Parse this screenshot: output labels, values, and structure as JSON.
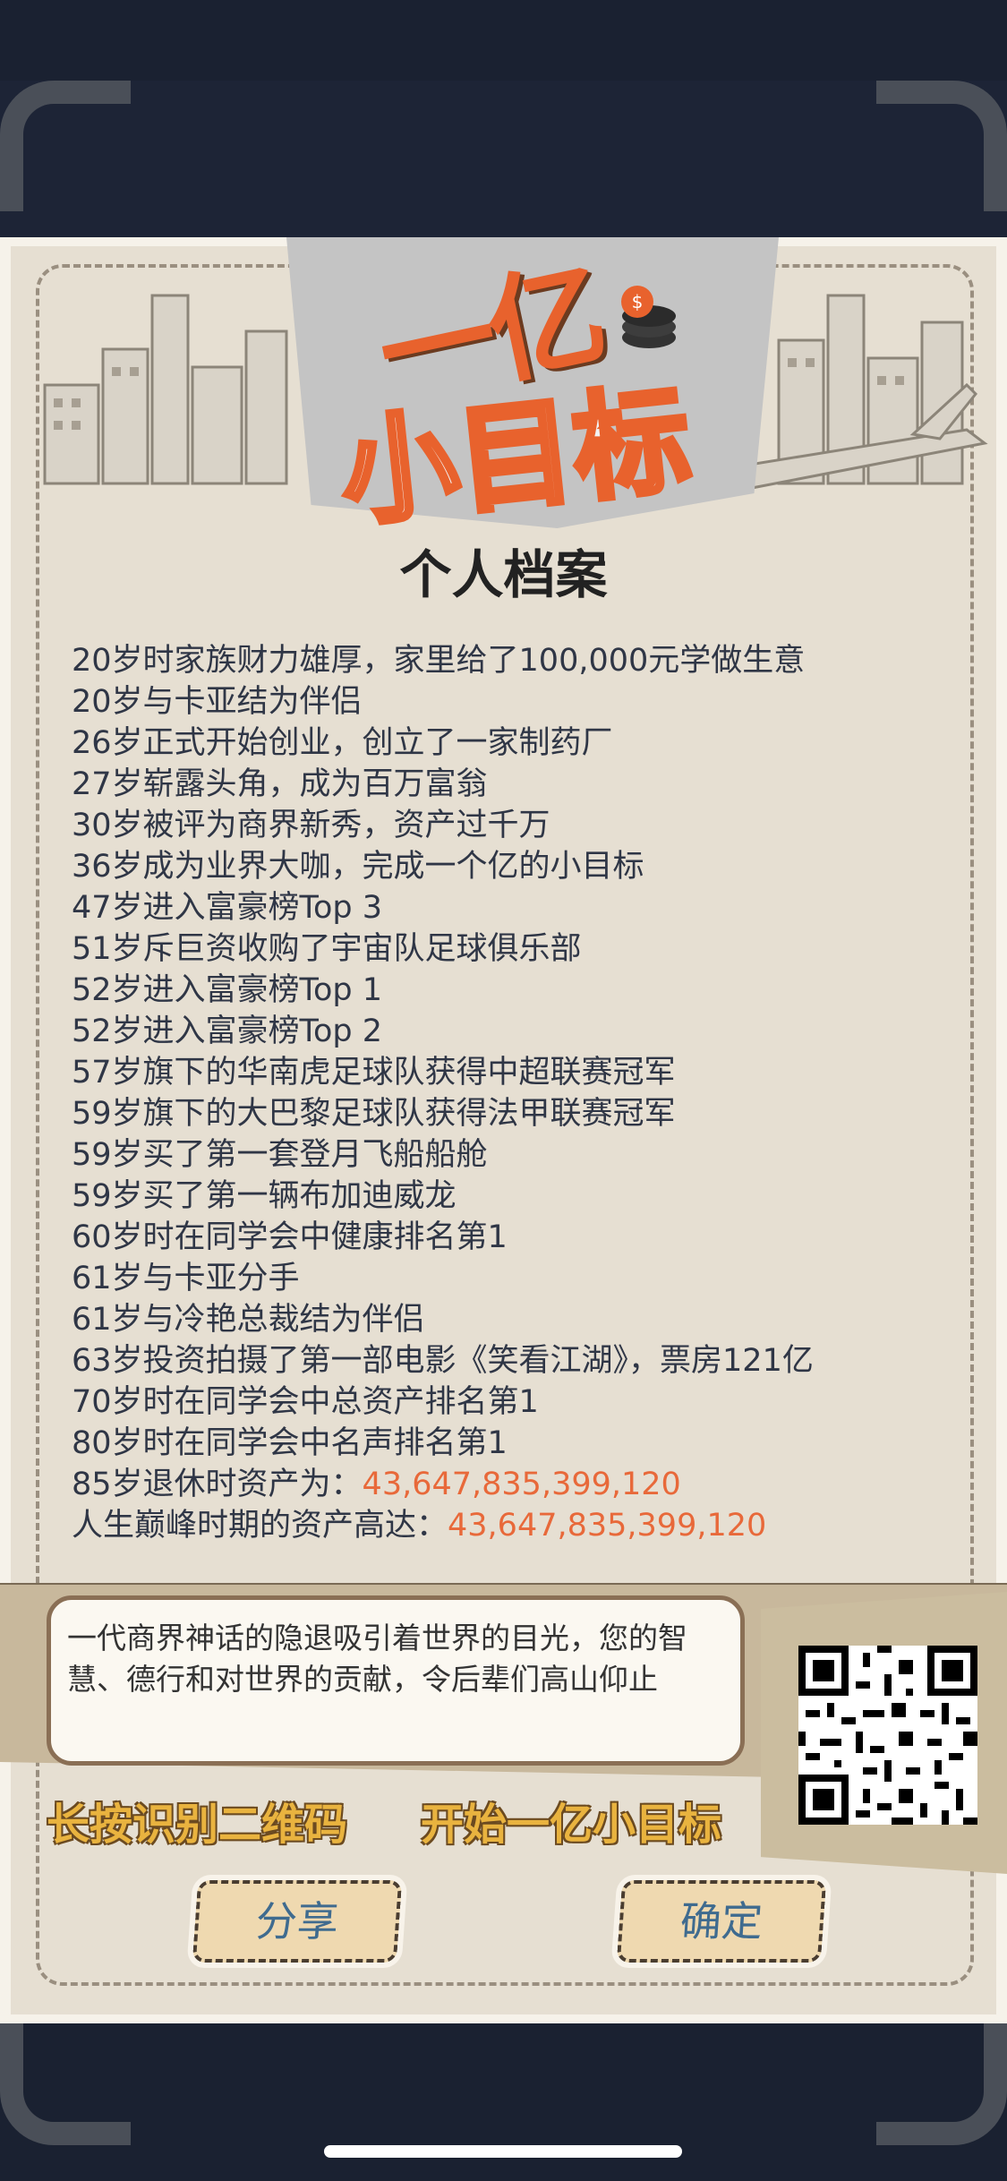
{
  "logo": {
    "line1": "一亿",
    "line2": "小目标"
  },
  "title": "个人档案",
  "events": [
    {
      "text": "20岁时家族财力雄厚，家里给了100,000元学做生意"
    },
    {
      "text": "20岁与卡亚结为伴侣"
    },
    {
      "text": "26岁正式开始创业，创立了一家制药厂"
    },
    {
      "text": "27岁崭露头角，成为百万富翁"
    },
    {
      "text": "30岁被评为商界新秀，资产过千万"
    },
    {
      "text": "36岁成为业界大咖，完成一个亿的小目标"
    },
    {
      "text": "47岁进入富豪榜Top 3"
    },
    {
      "text": "51岁斥巨资收购了宇宙队足球俱乐部"
    },
    {
      "text": "52岁进入富豪榜Top 1"
    },
    {
      "text": "52岁进入富豪榜Top 2"
    },
    {
      "text": "57岁旗下的华南虎足球队获得中超联赛冠军"
    },
    {
      "text": "59岁旗下的大巴黎足球队获得法甲联赛冠军"
    },
    {
      "text": "59岁买了第一套登月飞船船舱"
    },
    {
      "text": "59岁买了第一辆布加迪威龙"
    },
    {
      "text": "60岁时在同学会中健康排名第1"
    },
    {
      "text": "61岁与卡亚分手"
    },
    {
      "text": "61岁与冷艳总裁结为伴侣"
    },
    {
      "text": "63岁投资拍摄了第一部电影《笑看江湖》，票房121亿"
    },
    {
      "text": "70岁时在同学会中总资产排名第1"
    },
    {
      "text": "80岁时在同学会中名声排名第1"
    }
  ],
  "retire": {
    "label": "85岁退休时资产为：",
    "value": "43,647,835,399,120"
  },
  "peak": {
    "label": "人生巅峰时期的资产高达：",
    "value": "43,647,835,399,120"
  },
  "quote": "一代商界神话的隐退吸引着世界的目光，您的智慧、德行和对世界的贡献，令后辈们高山仰止",
  "cta": {
    "left": "长按识别二维码",
    "right": "开始一亿小目标"
  },
  "buttons": {
    "share": "分享",
    "confirm": "确定"
  },
  "colors": {
    "accent": "#e8693a",
    "cta": "#e9b33f",
    "button_text": "#3f6b8f"
  },
  "icons": {
    "coins": "coin-stack-icon",
    "qr": "qr-code-icon"
  }
}
